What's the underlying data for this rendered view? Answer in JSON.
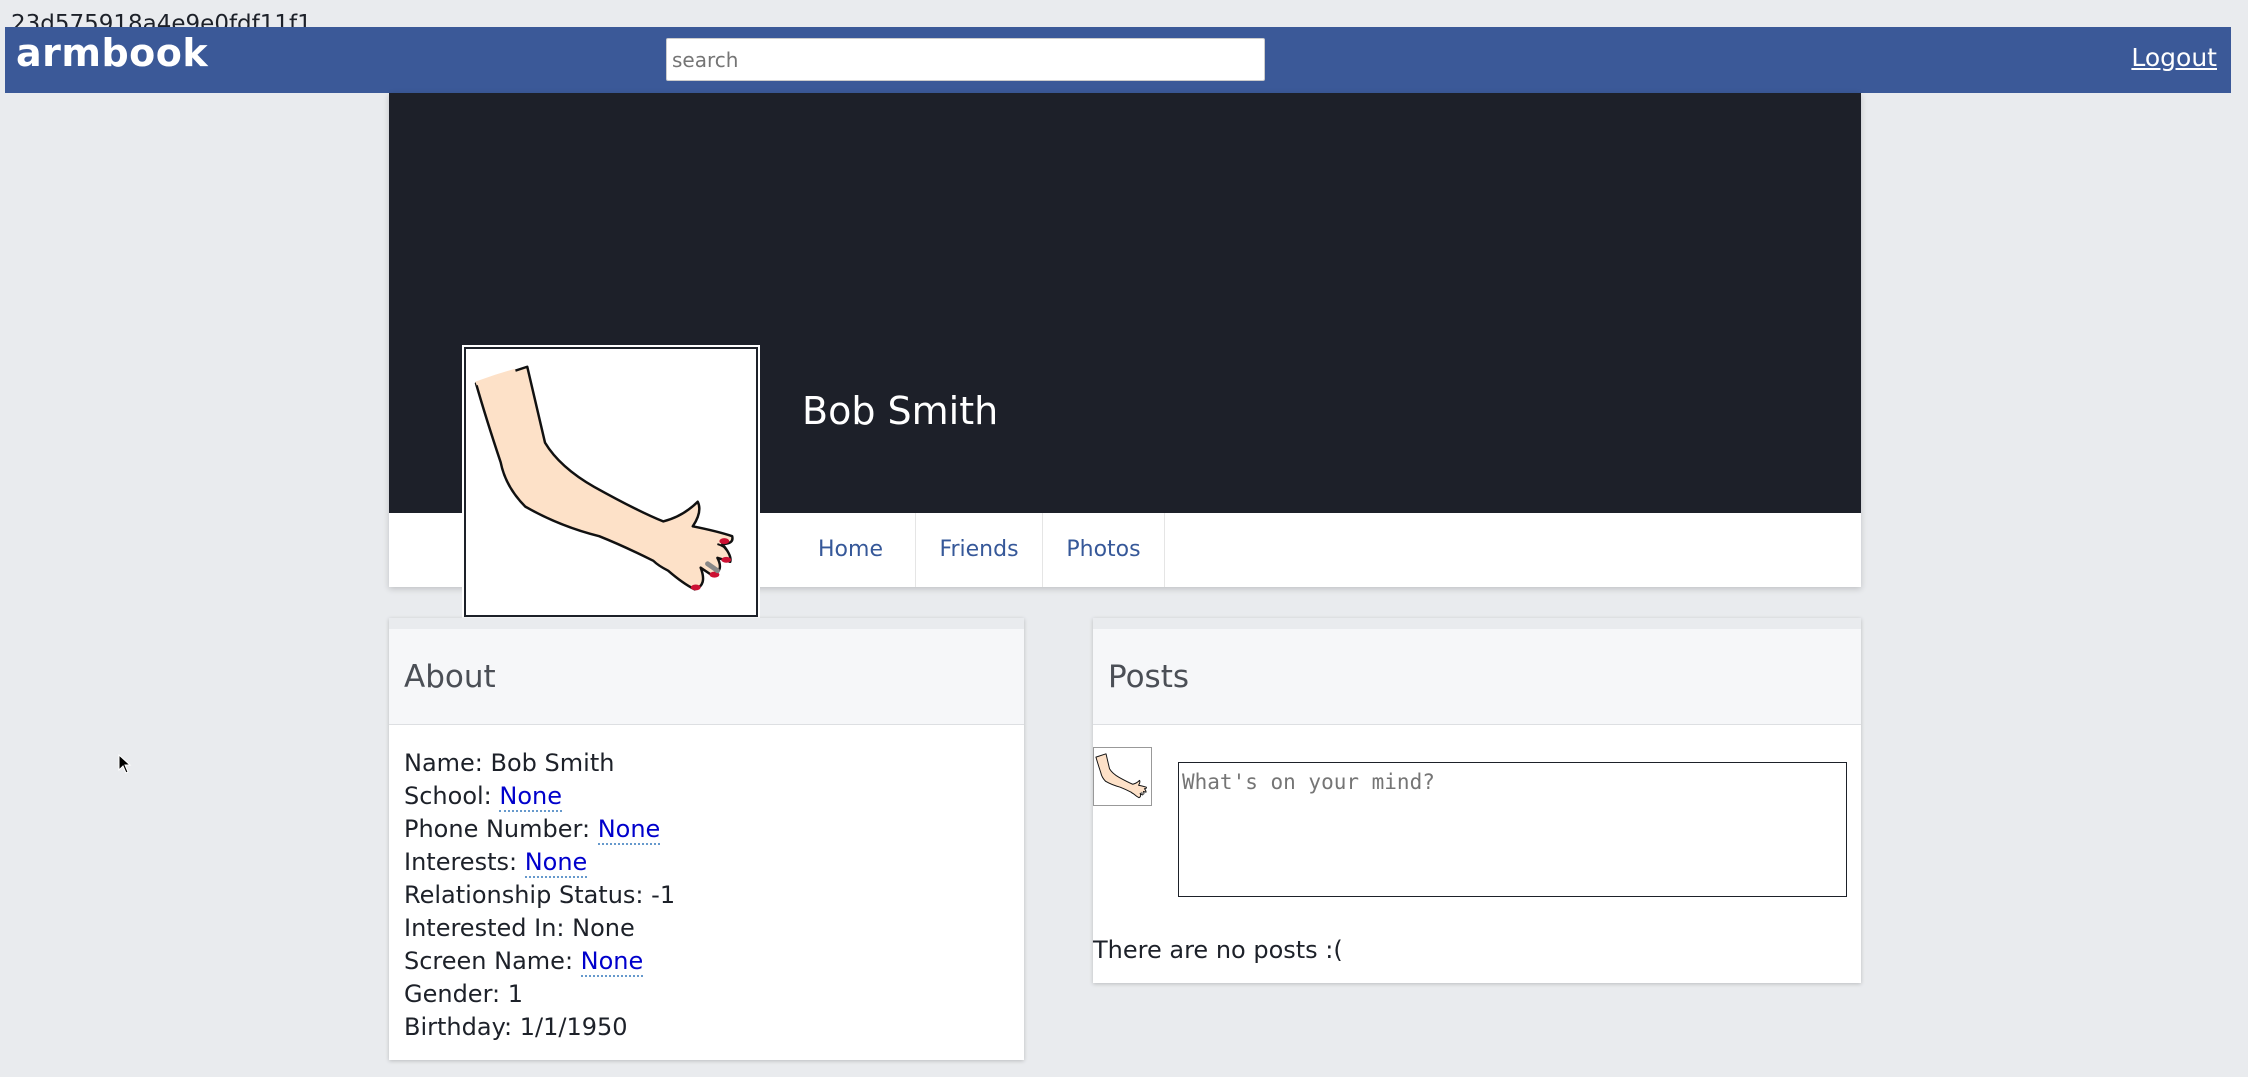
{
  "page_hash": "23d575918a4e9e0fdf11f1",
  "topbar": {
    "brand": "armbook",
    "search_placeholder": "search",
    "logout_label": "Logout",
    "color": "#3b5998"
  },
  "profile": {
    "name": "Bob Smith",
    "avatar_icon": "arm-hand-drawing-icon",
    "tabs": [
      {
        "label": "Home"
      },
      {
        "label": "Friends"
      },
      {
        "label": "Photos"
      }
    ]
  },
  "about": {
    "title": "About",
    "rows": [
      {
        "label": "Name: ",
        "value": "Bob Smith",
        "editable": false
      },
      {
        "label": "School: ",
        "value": "None",
        "editable": true
      },
      {
        "label": "Phone Number: ",
        "value": "None",
        "editable": true
      },
      {
        "label": "Interests: ",
        "value": "None",
        "editable": true
      },
      {
        "label": "Relationship Status: ",
        "value": "-1",
        "editable": false
      },
      {
        "label": "Interested In: ",
        "value": "None",
        "editable": false
      },
      {
        "label": "Screen Name: ",
        "value": "None",
        "editable": true
      },
      {
        "label": "Gender: ",
        "value": "1",
        "editable": false
      },
      {
        "label": "Birthday: ",
        "value": "1/1/1950",
        "editable": false
      }
    ]
  },
  "posts": {
    "title": "Posts",
    "composer_placeholder": "What's on your mind?",
    "empty_text": "There are no posts :("
  },
  "colors": {
    "background": "#e9ebee",
    "cover": "#1d2029",
    "link": "#365899",
    "editable_value": "#0000cc"
  }
}
